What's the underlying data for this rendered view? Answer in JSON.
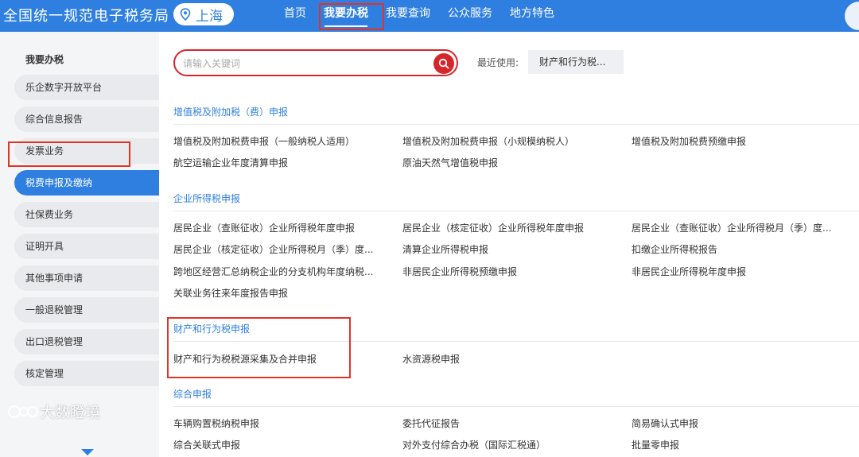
{
  "header": {
    "brand": "全国统一规范电子税务局",
    "city": "上海",
    "nav": [
      "首页",
      "我要办税",
      "我要查询",
      "公众服务",
      "地方特色"
    ]
  },
  "sidebar": {
    "title": "我要办税",
    "items": [
      "乐企数字开放平台",
      "综合信息报告",
      "发票业务",
      "税费申报及缴纳",
      "社保费业务",
      "证明开具",
      "其他事项申请",
      "一般退税管理",
      "出口退税管理",
      "核定管理"
    ],
    "active_index": 3
  },
  "search": {
    "placeholder": "请输入关键词",
    "value": "",
    "recent_label": "最近使用:",
    "recent_item": "财产和行为税..."
  },
  "sections": [
    {
      "title": "增值税及附加税（费）申报",
      "links": [
        "增值税及附加税费申报（一般纳税人适用）",
        "增值税及附加税费申报（小规模纳税人）",
        "增值税及附加税费预缴申报",
        "航空运输企业年度清算申报",
        "原油天然气增值税申报"
      ]
    },
    {
      "title": "企业所得税申报",
      "links": [
        "居民企业（查账征收）企业所得税年度申报",
        "居民企业（核定征收）企业所得税年度申报",
        "居民企业（查账征收）企业所得税月（季）度...",
        "居民企业（核定征收）企业所得税月（季）度...",
        "清算企业所得税申报",
        "扣缴企业所得税报告",
        "跨地区经营汇总纳税企业的分支机构年度纳税...",
        "非居民企业所得税预缴申报",
        "非居民企业所得税年度申报",
        "关联业务往来年度报告申报"
      ]
    },
    {
      "title": "财产和行为税申报",
      "links": [
        "财产和行为税税源采集及合并申报",
        "水资源税申报"
      ]
    },
    {
      "title": "综合申报",
      "links": [
        "车辆购置税纳税申报",
        "委托代征报告",
        "简易确认式申报",
        "综合关联式申报",
        "对外支付综合办税（国际汇税通）",
        "批量零申报"
      ]
    }
  ],
  "watermark": "大数瞪境",
  "colors": {
    "primary": "#2f7fe0",
    "accent_red": "#d7262b",
    "highlight_box": "#e53226",
    "sidebar_bg": "#f4f5f7"
  }
}
